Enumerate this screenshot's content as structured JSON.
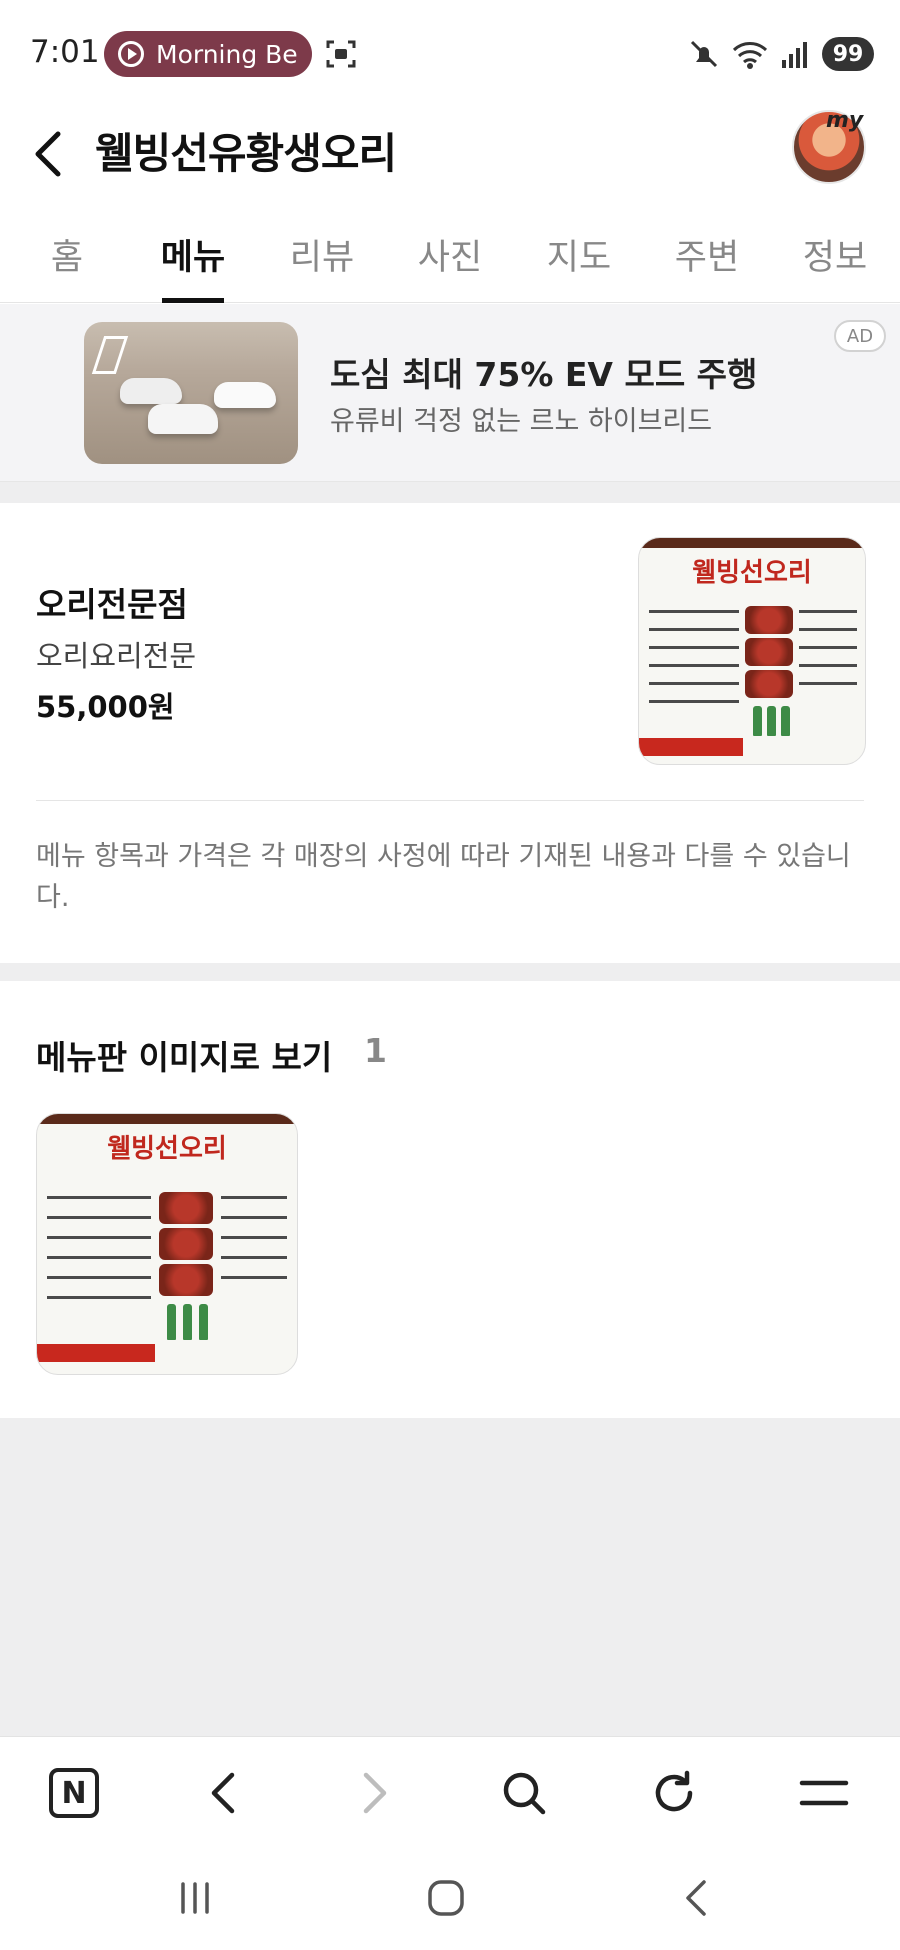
{
  "status_bar": {
    "time": "7:01",
    "media_title": "Morning Be",
    "battery": "99",
    "icons": [
      "play-icon",
      "screenshot-icon",
      "mute-icon",
      "wifi-icon",
      "signal-icon",
      "battery-icon"
    ]
  },
  "header": {
    "title": "웰빙선유황생오리",
    "avatar_label": "my"
  },
  "tabs": [
    {
      "label": "홈",
      "active": false
    },
    {
      "label": "메뉴",
      "active": true
    },
    {
      "label": "리뷰",
      "active": false
    },
    {
      "label": "사진",
      "active": false
    },
    {
      "label": "지도",
      "active": false
    },
    {
      "label": "주변",
      "active": false
    },
    {
      "label": "정보",
      "active": false
    }
  ],
  "ad": {
    "title": "도심 최대 75% EV 모드 주행",
    "subtitle": "유류비 걱정 없는 르노 하이브리드",
    "badge": "AD"
  },
  "menu_item": {
    "name": "오리전문점",
    "description": "오리요리전문",
    "price": "55,000원",
    "notice": "메뉴 항목과 가격은 각 매장의 사정에 따라 기재된 내용과 다를 수 있습니다."
  },
  "menu_board_image": {
    "title_text": "웰빙선오리"
  },
  "board_section": {
    "title": "메뉴판 이미지로 보기",
    "count": "1"
  },
  "bottom_bar": {
    "buttons": [
      "naver-home-icon",
      "back-icon",
      "forward-icon",
      "search-icon",
      "refresh-icon",
      "menu-icon"
    ],
    "home_letter": "N"
  },
  "colors": {
    "media_pill": "#7d3a4a",
    "text_primary": "#111111",
    "text_secondary": "#888888",
    "section_gap": "#eeeeef",
    "menu_board_red": "#c0281e"
  }
}
